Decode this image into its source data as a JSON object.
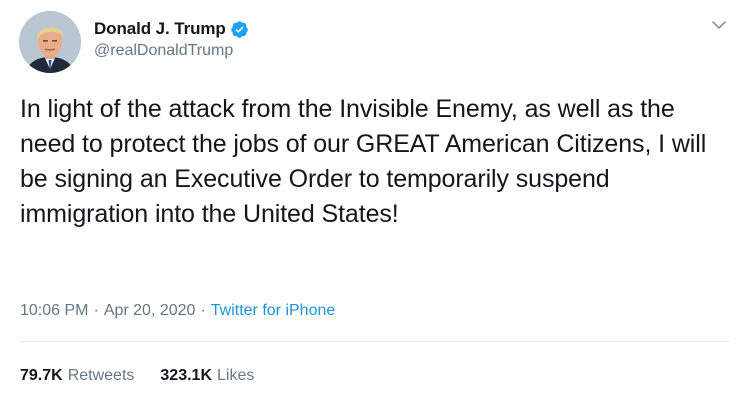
{
  "author": {
    "display_name": "Donald J. Trump",
    "handle": "@realDonaldTrump",
    "verified_icon": "verified-badge-icon",
    "avatar_icon": "avatar"
  },
  "menu": {
    "icon": "chevron-down-icon"
  },
  "tweet": {
    "text": "In light of the attack from the Invisible Enemy, as well as the need to protect the jobs of our GREAT American Citizens, I will be signing an Executive Order to temporarily suspend immigration into the United States!"
  },
  "meta": {
    "time": "10:06 PM",
    "separator": "·",
    "date": "Apr 20, 2020",
    "source": "Twitter for iPhone"
  },
  "stats": {
    "retweets_count": "79.7K",
    "retweets_label": "Retweets",
    "likes_count": "323.1K",
    "likes_label": "Likes"
  },
  "colors": {
    "text": "#14171a",
    "secondary": "#657786",
    "link": "#1b95e0",
    "verified": "#1da1f2",
    "divider": "#e6ecf0"
  }
}
